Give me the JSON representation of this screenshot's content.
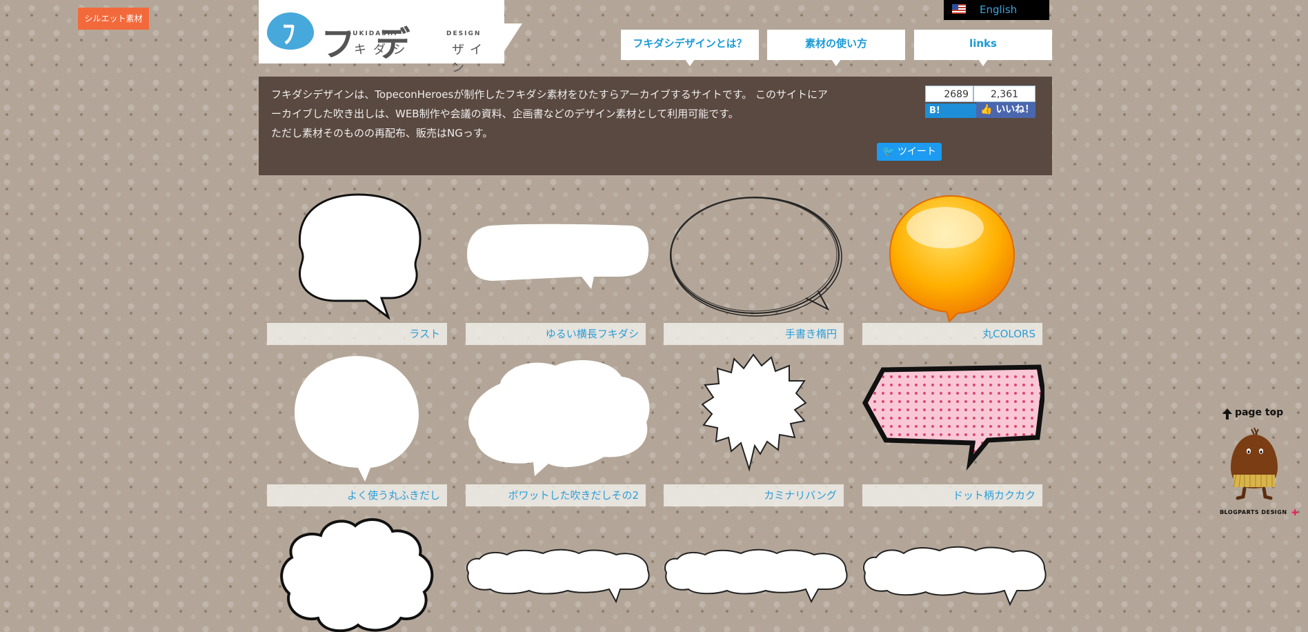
{
  "silhouette_tab": "シルエット素材",
  "logo": {
    "mark": "ﾌ",
    "main": "フ デ",
    "fukidashi": "FUKIDASHI",
    "design": "DESIGN",
    "kana1": "キダシ",
    "kana2": "ザイン"
  },
  "language": {
    "label": "English",
    "flag": "us-flag-icon"
  },
  "nav": [
    {
      "label": "フキダシデザインとは？"
    },
    {
      "label": "素材の使い方"
    },
    {
      "label": "links"
    }
  ],
  "intro": {
    "line1": "フキダシデザインは、TopeconHeroesが制作したフキダシ素材をひたすらアーカイブするサイトです。 このサイトにア",
    "line2": "ーカイブした吹き出しは、WEB制作や会議の資料、企画書などのデザイン素材として利用可能です。",
    "line3": "ただし素材そのものの再配布、販売はNGっす。"
  },
  "social": {
    "hatena_count": "2689",
    "hatena_label": "B! Bookm",
    "fb_count": "2,361",
    "fb_label": "いいね！",
    "tweet_label": "ツイート"
  },
  "items": [
    {
      "label": "ラスト",
      "shape": "rounded-bubble"
    },
    {
      "label": "ゆるい横長フキダシ",
      "shape": "wide-bubble"
    },
    {
      "label": "手書き楕円",
      "shape": "sketch-ellipse"
    },
    {
      "label": "丸COLORS",
      "shape": "orange-glossy"
    },
    {
      "label": "よく使う丸ふきだし",
      "shape": "round-bubble"
    },
    {
      "label": "ボワットした吹きだしその2",
      "shape": "cloud-bubble"
    },
    {
      "label": "カミナリバング",
      "shape": "spiky-burst"
    },
    {
      "label": "ドット柄カクカク",
      "shape": "dotted-angular"
    },
    {
      "label": "",
      "shape": "fluffy-cloud"
    },
    {
      "label": "",
      "shape": "wide-cloud"
    },
    {
      "label": "",
      "shape": "wide-cloud"
    },
    {
      "label": "",
      "shape": "wide-cloud"
    }
  ],
  "page_top": {
    "label": "page top",
    "footer": "BLOGPARTS DESIGN"
  },
  "colors": {
    "accent": "#1a9ad6",
    "tab_orange": "#f26a3c",
    "intro_bg": "#5a4940"
  }
}
